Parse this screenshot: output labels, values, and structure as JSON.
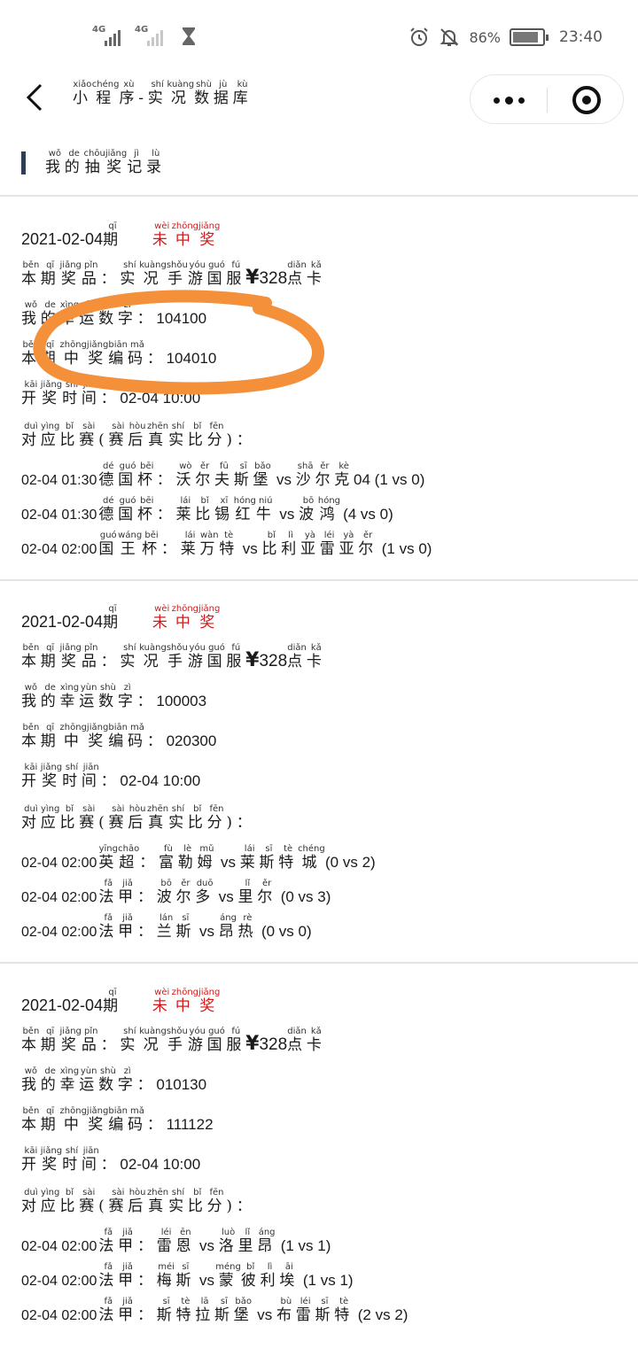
{
  "status_bar": {
    "signal1_label": "4G",
    "signal2_label": "4G",
    "battery_pct": "86%",
    "battery_level": 0.86,
    "time": "23:40",
    "icons": [
      "alarm-icon",
      "mute-bell-icon",
      "battery-icon",
      "hourglass-icon"
    ]
  },
  "header": {
    "title_chars": [
      {
        "h": "小",
        "p": "xiǎo"
      },
      {
        "h": "程",
        "p": "chéng"
      },
      {
        "h": "序",
        "p": "xù"
      },
      {
        "h": "-",
        "p": ""
      },
      {
        "h": "实",
        "p": "shí"
      },
      {
        "h": "况",
        "p": "kuàng"
      },
      {
        "h": "数",
        "p": "shù"
      },
      {
        "h": "据",
        "p": "jù"
      },
      {
        "h": "库",
        "p": "kù"
      }
    ]
  },
  "section": {
    "title_chars": [
      {
        "h": "我",
        "p": "wǒ"
      },
      {
        "h": "的",
        "p": "de"
      },
      {
        "h": "抽",
        "p": "chōu"
      },
      {
        "h": "奖",
        "p": "jiǎng"
      },
      {
        "h": "记",
        "p": "jì"
      },
      {
        "h": "录",
        "p": "lù"
      }
    ]
  },
  "labels": {
    "period": [
      {
        "h": "期",
        "p": "qī"
      }
    ],
    "status_not_won": [
      {
        "h": "未",
        "p": "wèi"
      },
      {
        "h": "中",
        "p": "zhōng"
      },
      {
        "h": "奖",
        "p": "jiǎng"
      }
    ],
    "prize_label": [
      {
        "h": "本",
        "p": "běn"
      },
      {
        "h": "期",
        "p": "qī"
      },
      {
        "h": "奖",
        "p": "jiǎng"
      },
      {
        "h": "品",
        "p": "pǐn"
      },
      {
        "h": "：",
        "p": ""
      }
    ],
    "prize_name": [
      {
        "h": "实",
        "p": "shí"
      },
      {
        "h": "况",
        "p": "kuàng"
      },
      {
        "h": "手",
        "p": "shǒu"
      },
      {
        "h": "游",
        "p": "yóu"
      },
      {
        "h": "国",
        "p": "guó"
      },
      {
        "h": "服",
        "p": "fú"
      }
    ],
    "prize_amount": "328",
    "prize_currency": "¥",
    "prize_unit": [
      {
        "h": "点",
        "p": "diǎn"
      },
      {
        "h": "卡",
        "p": "kǎ"
      }
    ],
    "lucky_label": [
      {
        "h": "我",
        "p": "wǒ"
      },
      {
        "h": "的",
        "p": "de"
      },
      {
        "h": "幸",
        "p": "xìng"
      },
      {
        "h": "运",
        "p": "yùn"
      },
      {
        "h": "数",
        "p": "shù"
      },
      {
        "h": "字",
        "p": "zì"
      },
      {
        "h": "：",
        "p": ""
      }
    ],
    "code_label": [
      {
        "h": "本",
        "p": "běn"
      },
      {
        "h": "期",
        "p": "qī"
      },
      {
        "h": "中",
        "p": "zhōng"
      },
      {
        "h": "奖",
        "p": "jiǎng"
      },
      {
        "h": "编",
        "p": "biān"
      },
      {
        "h": "码",
        "p": "mǎ"
      },
      {
        "h": "：",
        "p": ""
      }
    ],
    "draw_time_label": [
      {
        "h": "开",
        "p": "kāi"
      },
      {
        "h": "奖",
        "p": "jiǎng"
      },
      {
        "h": "时",
        "p": "shí"
      },
      {
        "h": "间",
        "p": "jiān"
      },
      {
        "h": "：",
        "p": ""
      }
    ],
    "matches_label": [
      {
        "h": "对",
        "p": "duì"
      },
      {
        "h": "应",
        "p": "yìng"
      },
      {
        "h": "比",
        "p": "bǐ"
      },
      {
        "h": "赛",
        "p": "sài"
      },
      {
        "h": "(",
        "p": ""
      },
      {
        "h": "赛",
        "p": "sài"
      },
      {
        "h": "后",
        "p": "hòu"
      },
      {
        "h": "真",
        "p": "zhēn"
      },
      {
        "h": "实",
        "p": "shí"
      },
      {
        "h": "比",
        "p": "bǐ"
      },
      {
        "h": "分",
        "p": "fēn"
      },
      {
        "h": ")",
        "p": ""
      },
      {
        "h": "：",
        "p": ""
      }
    ]
  },
  "records": [
    {
      "date": "2021-02-04",
      "lucky_number": "104100",
      "win_code": "104010",
      "draw_time": "02-04 10:00",
      "circled": true,
      "matches": [
        {
          "time": "02-04 01:30",
          "text": [
            {
              "h": "德",
              "p": "dé"
            },
            {
              "h": "国",
              "p": "guó"
            },
            {
              "h": "杯",
              "p": "bēi"
            },
            {
              "h": "：",
              "p": ""
            },
            {
              "h": "沃",
              "p": "wò"
            },
            {
              "h": "尔",
              "p": "ěr"
            },
            {
              "h": "夫",
              "p": "fū"
            },
            {
              "h": "斯",
              "p": "sī"
            },
            {
              "h": "堡",
              "p": "bǎo"
            },
            {
              "t": " vs "
            },
            {
              "h": "沙",
              "p": "shā"
            },
            {
              "h": "尔",
              "p": "ěr"
            },
            {
              "h": "克",
              "p": "kè"
            },
            {
              "t": "04 (1 vs 0)"
            }
          ]
        },
        {
          "time": "02-04 01:30",
          "text": [
            {
              "h": "德",
              "p": "dé"
            },
            {
              "h": "国",
              "p": "guó"
            },
            {
              "h": "杯",
              "p": "bēi"
            },
            {
              "h": "：",
              "p": ""
            },
            {
              "h": "莱",
              "p": "lái"
            },
            {
              "h": "比",
              "p": "bǐ"
            },
            {
              "h": "锡",
              "p": "xī"
            },
            {
              "h": "红",
              "p": "hóng"
            },
            {
              "h": "牛",
              "p": "niú"
            },
            {
              "t": " vs "
            },
            {
              "h": "波",
              "p": "bō"
            },
            {
              "h": "鸿",
              "p": "hóng"
            },
            {
              "t": " (4 vs 0)"
            }
          ]
        },
        {
          "time": "02-04 02:00",
          "text": [
            {
              "h": "国",
              "p": "guó"
            },
            {
              "h": "王",
              "p": "wáng"
            },
            {
              "h": "杯",
              "p": "bēi"
            },
            {
              "h": "：",
              "p": ""
            },
            {
              "h": "莱",
              "p": "lái"
            },
            {
              "h": "万",
              "p": "wàn"
            },
            {
              "h": "特",
              "p": "tè"
            },
            {
              "t": " vs "
            },
            {
              "h": "比",
              "p": "bǐ"
            },
            {
              "h": "利",
              "p": "lì"
            },
            {
              "h": "亚",
              "p": "yà"
            },
            {
              "h": "雷",
              "p": "léi"
            },
            {
              "h": "亚",
              "p": "yà"
            },
            {
              "h": "尔",
              "p": "ěr"
            },
            {
              "t": " (1 vs 0)"
            }
          ]
        }
      ]
    },
    {
      "date": "2021-02-04",
      "lucky_number": "100003",
      "win_code": "020300",
      "draw_time": "02-04 10:00",
      "circled": false,
      "matches": [
        {
          "time": "02-04 02:00",
          "text": [
            {
              "h": "英",
              "p": "yīng"
            },
            {
              "h": "超",
              "p": "chāo"
            },
            {
              "h": "：",
              "p": ""
            },
            {
              "h": "富",
              "p": "fù"
            },
            {
              "h": "勒",
              "p": "lè"
            },
            {
              "h": "姆",
              "p": "mǔ"
            },
            {
              "t": " vs "
            },
            {
              "h": "莱",
              "p": "lái"
            },
            {
              "h": "斯",
              "p": "sī"
            },
            {
              "h": "特",
              "p": "tè"
            },
            {
              "h": "城",
              "p": "chéng"
            },
            {
              "t": " (0 vs 2)"
            }
          ]
        },
        {
          "time": "02-04 02:00",
          "text": [
            {
              "h": "法",
              "p": "fǎ"
            },
            {
              "h": "甲",
              "p": "jiǎ"
            },
            {
              "h": "：",
              "p": ""
            },
            {
              "h": "波",
              "p": "bō"
            },
            {
              "h": "尔",
              "p": "ěr"
            },
            {
              "h": "多",
              "p": "duō"
            },
            {
              "t": " vs "
            },
            {
              "h": "里",
              "p": "lǐ"
            },
            {
              "h": "尔",
              "p": "ěr"
            },
            {
              "t": " (0 vs 3)"
            }
          ]
        },
        {
          "time": "02-04 02:00",
          "text": [
            {
              "h": "法",
              "p": "fǎ"
            },
            {
              "h": "甲",
              "p": "jiǎ"
            },
            {
              "h": "：",
              "p": ""
            },
            {
              "h": "兰",
              "p": "lán"
            },
            {
              "h": "斯",
              "p": "sī"
            },
            {
              "t": " vs "
            },
            {
              "h": "昂",
              "p": "áng"
            },
            {
              "h": "热",
              "p": "rè"
            },
            {
              "t": " (0 vs 0)"
            }
          ]
        }
      ]
    },
    {
      "date": "2021-02-04",
      "lucky_number": "010130",
      "win_code": "111122",
      "draw_time": "02-04 10:00",
      "circled": false,
      "matches": [
        {
          "time": "02-04 02:00",
          "text": [
            {
              "h": "法",
              "p": "fǎ"
            },
            {
              "h": "甲",
              "p": "jiǎ"
            },
            {
              "h": "：",
              "p": ""
            },
            {
              "h": "雷",
              "p": "léi"
            },
            {
              "h": "恩",
              "p": "ēn"
            },
            {
              "t": " vs "
            },
            {
              "h": "洛",
              "p": "luò"
            },
            {
              "h": "里",
              "p": "lǐ"
            },
            {
              "h": "昂",
              "p": "áng"
            },
            {
              "t": " (1 vs 1)"
            }
          ]
        },
        {
          "time": "02-04 02:00",
          "text": [
            {
              "h": "法",
              "p": "fǎ"
            },
            {
              "h": "甲",
              "p": "jiǎ"
            },
            {
              "h": "：",
              "p": ""
            },
            {
              "h": "梅",
              "p": "méi"
            },
            {
              "h": "斯",
              "p": "sī"
            },
            {
              "t": " vs "
            },
            {
              "h": "蒙",
              "p": "méng"
            },
            {
              "h": "彼",
              "p": "bǐ"
            },
            {
              "h": "利",
              "p": "lì"
            },
            {
              "h": "埃",
              "p": "āi"
            },
            {
              "t": " (1 vs 1)"
            }
          ]
        },
        {
          "time": "02-04 02:00",
          "text": [
            {
              "h": "法",
              "p": "fǎ"
            },
            {
              "h": "甲",
              "p": "jiǎ"
            },
            {
              "h": "：",
              "p": ""
            },
            {
              "h": "斯",
              "p": "sī"
            },
            {
              "h": "特",
              "p": "tè"
            },
            {
              "h": "拉",
              "p": "lā"
            },
            {
              "h": "斯",
              "p": "sī"
            },
            {
              "h": "堡",
              "p": "bǎo"
            },
            {
              "t": " vs "
            },
            {
              "h": "布",
              "p": "bù"
            },
            {
              "h": "雷",
              "p": "léi"
            },
            {
              "h": "斯",
              "p": "sī"
            },
            {
              "h": "特",
              "p": "tè"
            },
            {
              "t": " (2 vs 2)"
            }
          ]
        }
      ]
    }
  ]
}
